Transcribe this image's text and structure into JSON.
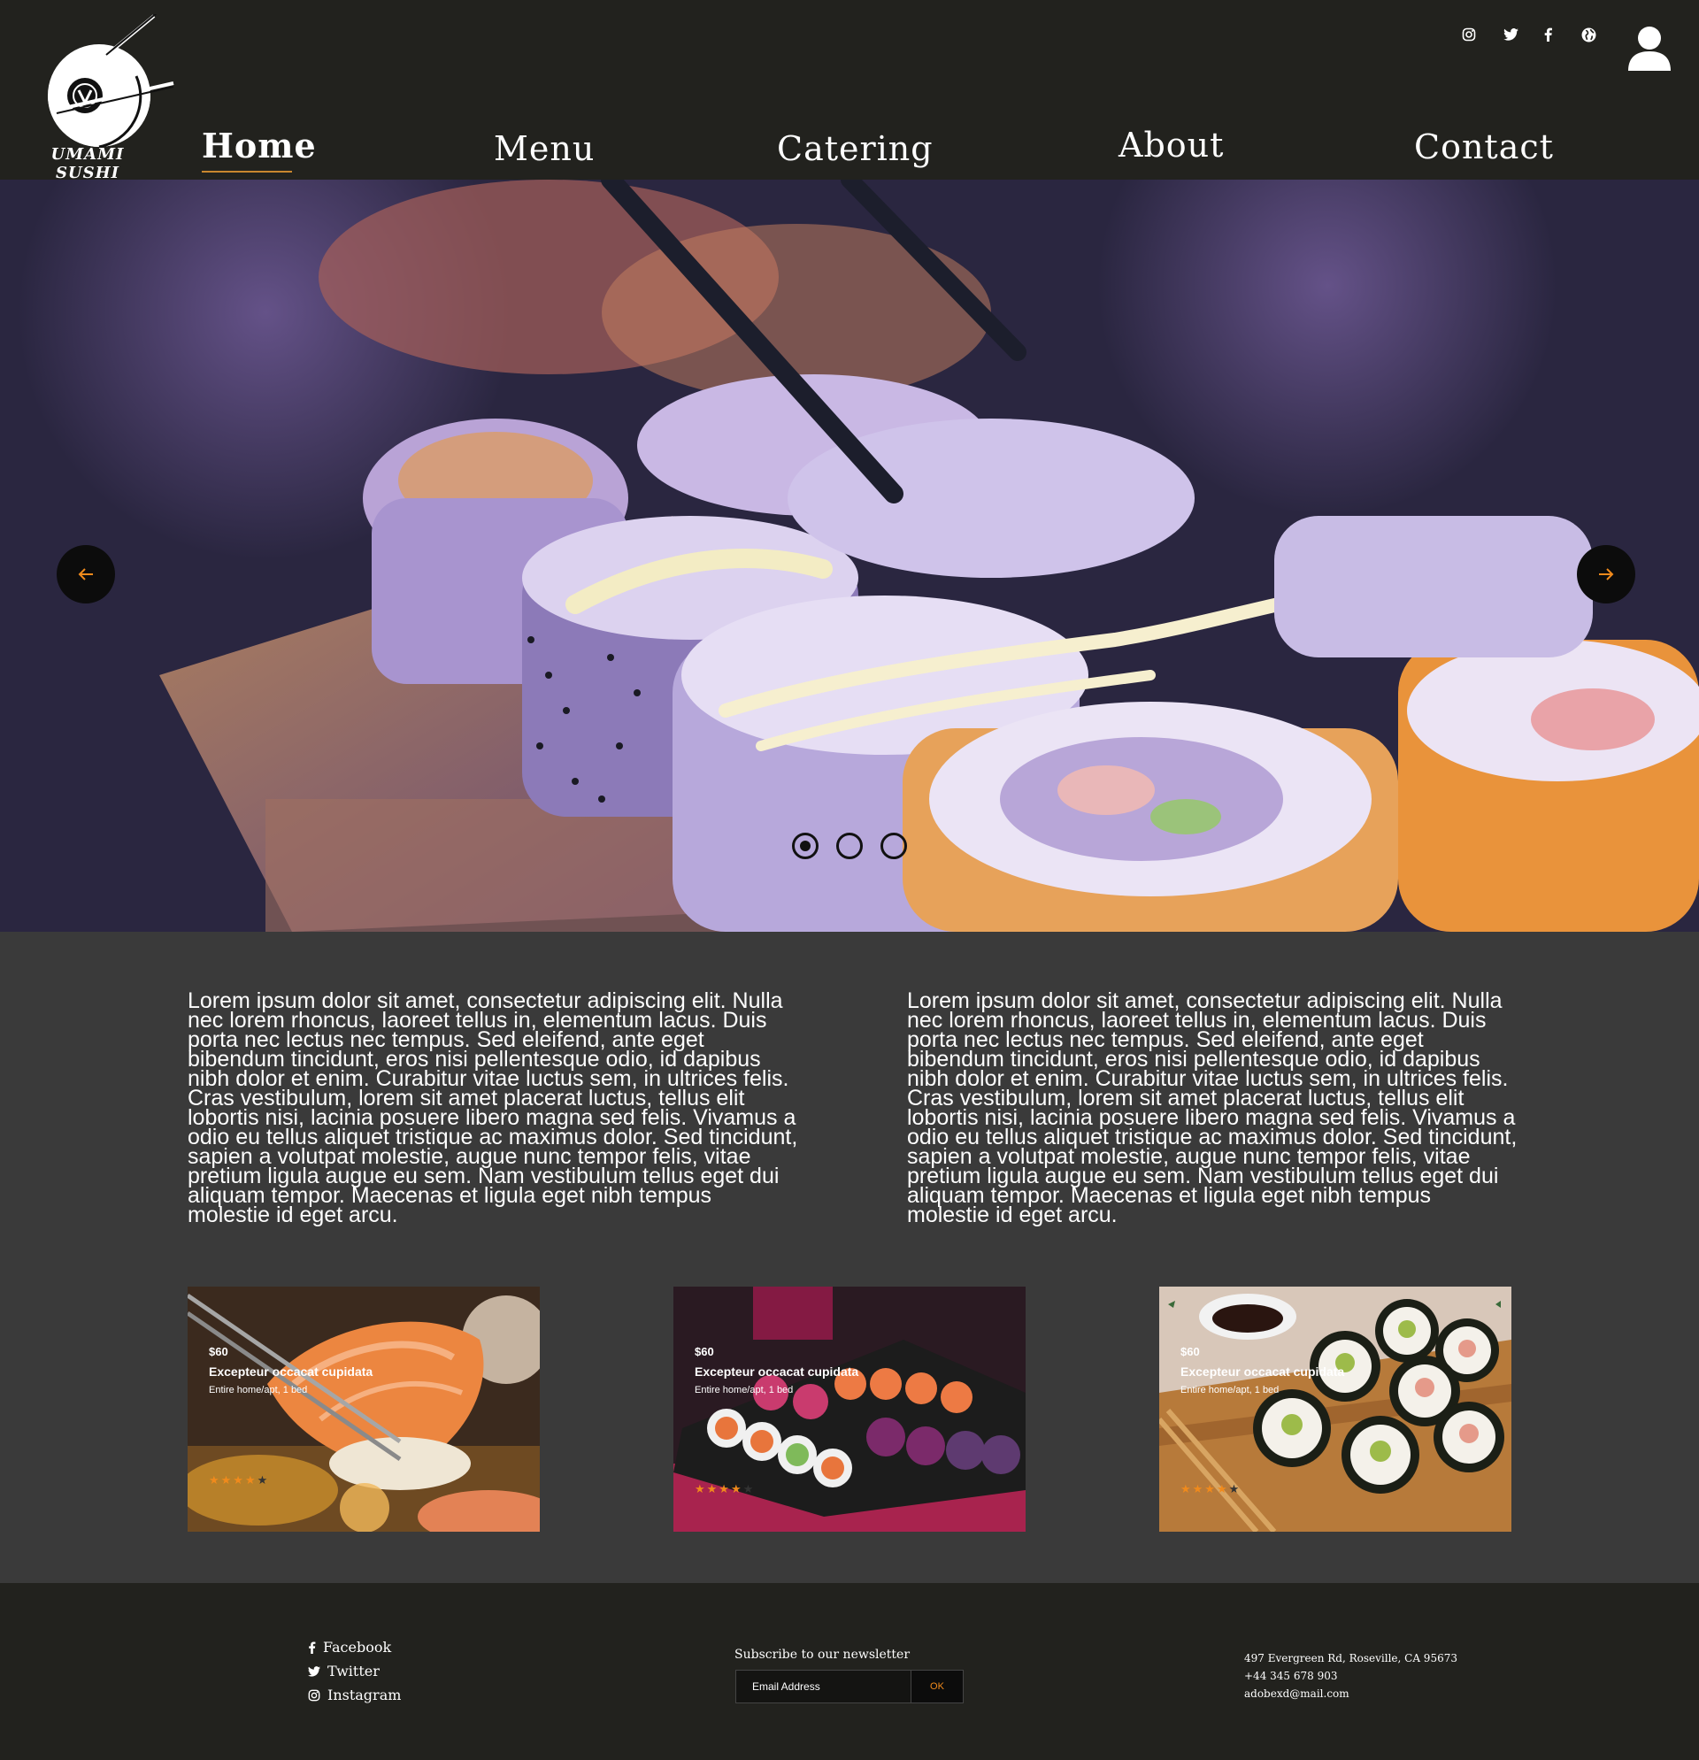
{
  "brand": {
    "name": "UMAMI SUSHI",
    "accent": "#f08a1c",
    "header_bg": "#22221e",
    "body_bg": "#3a3a3a"
  },
  "nav": {
    "items": [
      {
        "label": "Home",
        "active": true
      },
      {
        "label": "Menu",
        "active": false
      },
      {
        "label": "Catering",
        "active": false
      },
      {
        "label": "About",
        "active": false
      },
      {
        "label": "Contact",
        "active": false
      }
    ]
  },
  "social_icons": [
    "instagram-icon",
    "twitter-icon",
    "facebook-icon",
    "globe-icon"
  ],
  "user_icon": "user-icon",
  "hero": {
    "prev_icon": "arrow-left-icon",
    "next_icon": "arrow-right-icon",
    "slides": 3,
    "active_slide": 1
  },
  "content": {
    "para_left": "Lorem ipsum dolor sit amet, consectetur adipiscing elit. Nulla nec lorem rhoncus, laoreet tellus in, elementum lacus. Duis porta nec lectus nec tempus. Sed eleifend, ante eget bibendum tincidunt, eros nisi pellentesque odio, id dapibus nibh dolor et enim. Curabitur vitae luctus sem, in ultrices felis. Cras vestibulum, lorem sit amet placerat luctus, tellus elit lobortis nisi, lacinia posuere libero magna sed felis. Vivamus a odio eu tellus aliquet tristique ac maximus dolor. Sed tincidunt, sapien a volutpat molestie, augue nunc tempor felis, vitae pretium ligula augue eu sem. Nam vestibulum tellus eget dui aliquam tempor. Maecenas et ligula eget nibh tempus molestie id eget arcu.",
    "para_right": "Lorem ipsum dolor sit amet, consectetur adipiscing elit. Nulla nec lorem rhoncus, laoreet tellus in, elementum lacus. Duis porta nec lectus nec tempus. Sed eleifend, ante eget bibendum tincidunt, eros nisi pellentesque odio, id dapibus nibh dolor et enim. Curabitur vitae luctus sem, in ultrices felis. Cras vestibulum, lorem sit amet placerat luctus, tellus elit lobortis nisi, lacinia posuere libero magna sed felis. Vivamus a odio eu tellus aliquet tristique ac maximus dolor. Sed tincidunt, sapien a volutpat molestie, augue nunc tempor felis, vitae pretium ligula augue eu sem. Nam vestibulum tellus eget dui aliquam tempor. Maecenas et ligula eget nibh tempus molestie id eget arcu."
  },
  "cards": [
    {
      "price": "$60",
      "title": "Excepteur occacat cupidata",
      "subtitle": "Entire home/apt, 1 bed",
      "rating": 4,
      "max_rating": 5
    },
    {
      "price": "$60",
      "title": "Excepteur occacat cupidata",
      "subtitle": "Entire home/apt, 1 bed",
      "rating": 4,
      "max_rating": 5
    },
    {
      "price": "$60",
      "title": "Excepteur occacat cupidata",
      "subtitle": "Entire home/apt, 1 bed",
      "rating": 4,
      "max_rating": 5
    }
  ],
  "footer": {
    "links": [
      {
        "label": "Facebook",
        "icon": "facebook-icon"
      },
      {
        "label": "Twitter",
        "icon": "twitter-icon"
      },
      {
        "label": "Instagram",
        "icon": "instagram-icon"
      }
    ],
    "newsletter": {
      "label": "Subscribe to our newsletter",
      "placeholder": "Email Address",
      "button": "OK"
    },
    "contact": {
      "address": "497 Evergreen Rd, Roseville, CA 95673",
      "phone": "+44 345 678 903",
      "email": "adobexd@mail.com"
    }
  }
}
